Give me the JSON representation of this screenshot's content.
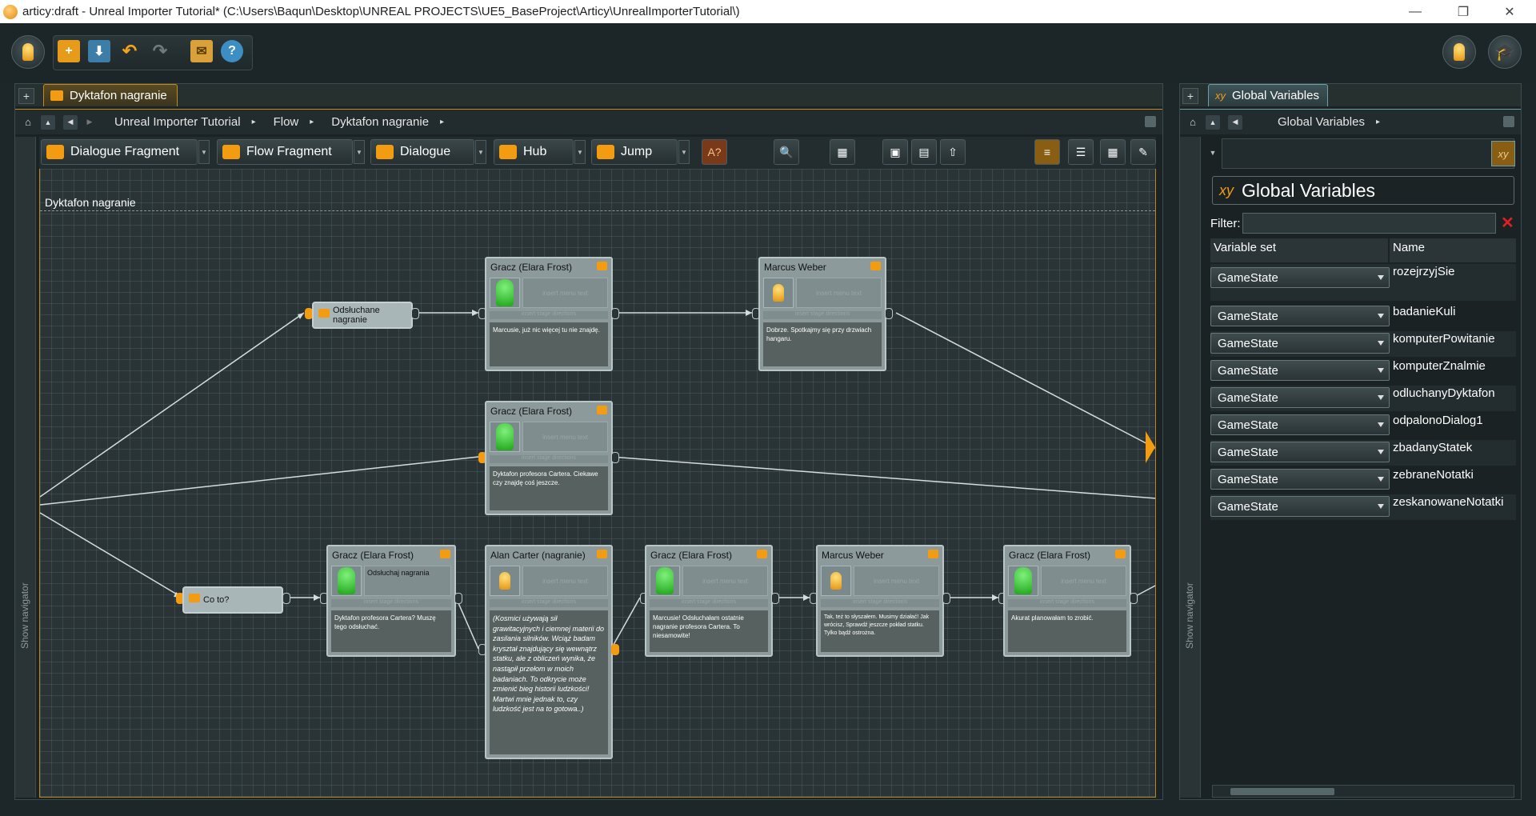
{
  "window": {
    "title": "articy:draft - Unreal Importer Tutorial* (C:\\Users\\Baqun\\Desktop\\UNREAL PROJECTS\\UE5_BaseProject\\Articy\\UnrealImporterTutorial\\)",
    "minimize": "—",
    "restore": "❐",
    "close": "✕"
  },
  "toolbar": {
    "new": "+",
    "save": "⬇",
    "undo": "↶",
    "redo": "↷",
    "mail": "✉",
    "help": "?"
  },
  "left_panel": {
    "tab_plus": "+",
    "tab_label": "Dyktafon nagranie",
    "breadcrumb": [
      "Unreal Importer Tutorial",
      "Flow",
      "Dyktafon nagranie"
    ],
    "crumb_sep": "▸",
    "tools": [
      {
        "label": "Dialogue Fragment"
      },
      {
        "label": "Flow Fragment"
      },
      {
        "label": "Dialogue"
      },
      {
        "label": "Hub"
      },
      {
        "label": "Jump"
      }
    ],
    "spellcheck": "A?",
    "canvas_title": "Dyktafon nagranie",
    "navigator_label": "Show navigator"
  },
  "nodes": {
    "n1": {
      "speaker": "Gracz (Elara Frost)",
      "menu": "insert menu text",
      "stage": "insert stage directions",
      "text": "Marcusie, już nic więcej tu nie znajdę."
    },
    "n2": {
      "speaker": "Marcus Weber",
      "menu": "insert menu text",
      "stage": "insert stage directions",
      "text": "Dobrze. Spotkajmy się przy drzwiach hangaru."
    },
    "n3": {
      "speaker": "Gracz (Elara Frost)",
      "menu": "insert menu text",
      "stage": "insert stage directions",
      "text": "Dyktafon profesora Cartera. Ciekawe czy znajdę coś jeszcze."
    },
    "n4": {
      "speaker": "Gracz (Elara Frost)",
      "menu": "Odsłuchaj nagrania",
      "stage": "insert stage directions",
      "text": "Dyktafon profesora Cartera? Muszę tego odsłuchać."
    },
    "n5": {
      "speaker": "Alan Carter (nagranie)",
      "menu": "insert menu text",
      "stage": "insert stage directions",
      "text": "(Kosmici używają sił grawitacyjnych i ciemnej materii do zasilania silników. Wciąż badam kryształ znajdujący się wewnątrz statku, ale z obliczeń wynika, że nastąpił przełom w moich badaniach. To odkrycie może zmienić bieg historii ludzkości! Martwi mnie jednak to, czy ludzkość jest na to gotowa..)"
    },
    "n6": {
      "speaker": "Gracz (Elara Frost)",
      "menu": "insert menu text",
      "stage": "insert stage directions",
      "text": "Marcusie! Odsłuchałam ostatnie nagranie profesora Cartera. To niesamowite!"
    },
    "n7": {
      "speaker": "Marcus Weber",
      "menu": "insert menu text",
      "stage": "insert stage directions",
      "text": "Tak, też to słyszałem. Musimy działać! Jak wrócisz, Sprawdź jeszcze pokład statku. Tylko bądź ostrożna."
    },
    "n8": {
      "speaker": "Gracz (Elara Frost)",
      "menu": "insert menu text",
      "stage": "insert stage directions",
      "text": "Akurat planowałam to zrobić."
    },
    "hub1": {
      "label": "Odsłuchane nagranie"
    },
    "hub2": {
      "label": "Co to?"
    }
  },
  "right_panel": {
    "tab_plus": "+",
    "tab_label": "Global Variables",
    "breadcrumb": [
      "Global Variables"
    ],
    "heading": "Global Variables",
    "filter_label": "Filter:",
    "filter_value": "",
    "filter_clear": "✕",
    "columns": [
      "Variable set",
      "Name"
    ],
    "rows": [
      {
        "set": "GameState",
        "name": "rozejrzyjSie"
      },
      {
        "set": "GameState",
        "name": "badanieKuli"
      },
      {
        "set": "GameState",
        "name": "komputerPowitanie"
      },
      {
        "set": "GameState",
        "name": "komputerZnalmie"
      },
      {
        "set": "GameState",
        "name": "odluchanyDyktafon"
      },
      {
        "set": "GameState",
        "name": "odpalonoDialog1"
      },
      {
        "set": "GameState",
        "name": "zbadanyStatek"
      },
      {
        "set": "GameState",
        "name": "zebraneNotatki"
      },
      {
        "set": "GameState",
        "name": "zeskanowaneNotatki"
      }
    ],
    "navigator_label": "Show navigator"
  },
  "colors": {
    "accent": "#f39c12",
    "tab_border": "#c48a1a",
    "node": "#8c9a9c",
    "canvas": "#2a3436"
  }
}
